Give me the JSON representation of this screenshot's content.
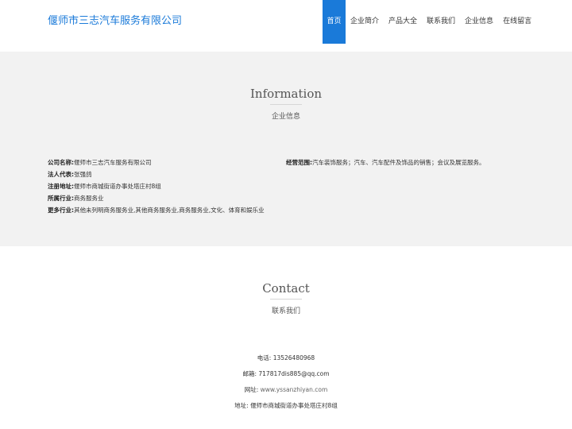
{
  "header": {
    "brand": "偃师市三志汽车服务有限公司",
    "nav": [
      {
        "label": "首页",
        "active": true
      },
      {
        "label": "企业简介"
      },
      {
        "label": "产品大全"
      },
      {
        "label": "联系我们"
      },
      {
        "label": "企业信息"
      },
      {
        "label": "在线留言"
      }
    ]
  },
  "info": {
    "title": "Information",
    "subtitle": "企业信息",
    "left": [
      {
        "key": "公司名称:",
        "value": "偃师市三志汽车服务有限公司"
      },
      {
        "key": "法人代表:",
        "value": "张强鸽"
      },
      {
        "key": "注册地址:",
        "value": "偃师市商城街道办事处塔庄村8组"
      },
      {
        "key": "所属行业:",
        "value": "商务服务业"
      },
      {
        "key": "更多行业:",
        "value": "其他未列明商务服务业,其他商务服务业,商务服务业,文化、体育和娱乐业"
      }
    ],
    "right": [
      {
        "key": "经营范围:",
        "value": "汽车装饰服务；汽车、汽车配件及饰品的销售；会议及展览服务。"
      }
    ]
  },
  "contact": {
    "title": "Contact",
    "subtitle": "联系我们",
    "rows": [
      {
        "key": "电话:",
        "value": "13526480968"
      },
      {
        "key": "邮箱:",
        "value": "717817dis885@qq.com"
      },
      {
        "key": "网址:",
        "value": "www.yssanzhiyan.com"
      },
      {
        "key": "地址:",
        "value": "偃师市商城街道办事处塔庄村8组"
      }
    ]
  }
}
